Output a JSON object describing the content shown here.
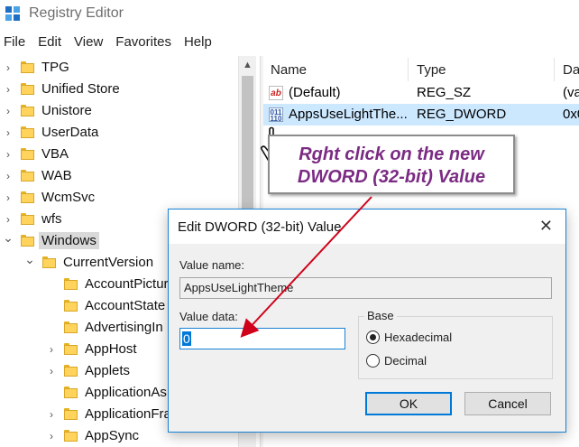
{
  "window": {
    "title": "Registry Editor"
  },
  "menu": [
    "File",
    "Edit",
    "View",
    "Favorites",
    "Help"
  ],
  "tree": {
    "items": [
      {
        "label": "TPG",
        "expanded": false,
        "level": 0
      },
      {
        "label": "Unified Store",
        "expanded": false,
        "level": 0
      },
      {
        "label": "Unistore",
        "expanded": false,
        "level": 0
      },
      {
        "label": "UserData",
        "expanded": false,
        "level": 0
      },
      {
        "label": "VBA",
        "expanded": false,
        "level": 0
      },
      {
        "label": "WAB",
        "expanded": false,
        "level": 0
      },
      {
        "label": "WcmSvc",
        "expanded": false,
        "level": 0
      },
      {
        "label": "wfs",
        "expanded": false,
        "level": 0
      },
      {
        "label": "Windows",
        "expanded": true,
        "level": 0,
        "selected": true
      },
      {
        "label": "CurrentVersion",
        "expanded": true,
        "level": 1
      },
      {
        "label": "AccountPictur",
        "expanded": null,
        "level": 2
      },
      {
        "label": "AccountState",
        "expanded": null,
        "level": 2
      },
      {
        "label": "AdvertisingIn",
        "expanded": null,
        "level": 2
      },
      {
        "label": "AppHost",
        "expanded": false,
        "level": 2
      },
      {
        "label": "Applets",
        "expanded": false,
        "level": 2
      },
      {
        "label": "ApplicationAs",
        "expanded": null,
        "level": 2
      },
      {
        "label": "ApplicationFra",
        "expanded": false,
        "level": 2
      },
      {
        "label": "AppSync",
        "expanded": false,
        "level": 2
      }
    ]
  },
  "list": {
    "columns": [
      "Name",
      "Type",
      "Da"
    ],
    "rows": [
      {
        "name": "(Default)",
        "type": "REG_SZ",
        "data": "(va",
        "icon": "string-value-icon",
        "icon_glyph": "ab"
      },
      {
        "name": "AppsUseLightThe...",
        "type": "REG_DWORD",
        "data": "0x0",
        "icon": "binary-value-icon",
        "icon_glyph": "011 110",
        "selected": true
      }
    ]
  },
  "callout": {
    "line1": "Rght click on the new",
    "line2": "DWORD (32-bit) Value",
    "color": "#7b2b83"
  },
  "dialog": {
    "title": "Edit DWORD (32-bit) Value",
    "close_glyph": "✕",
    "value_name_label": "Value name:",
    "value_name": "AppsUseLightTheme",
    "value_data_label": "Value data:",
    "value_data": "0",
    "base_label": "Base",
    "radio_hex": "Hexadecimal",
    "radio_dec": "Decimal",
    "base_selected": "Hexadecimal",
    "ok_label": "OK",
    "cancel_label": "Cancel"
  },
  "colors": {
    "accent": "#0078d7",
    "selection": "#cce8ff",
    "arrow": "#d0021b",
    "folder": "#ffd35c"
  }
}
